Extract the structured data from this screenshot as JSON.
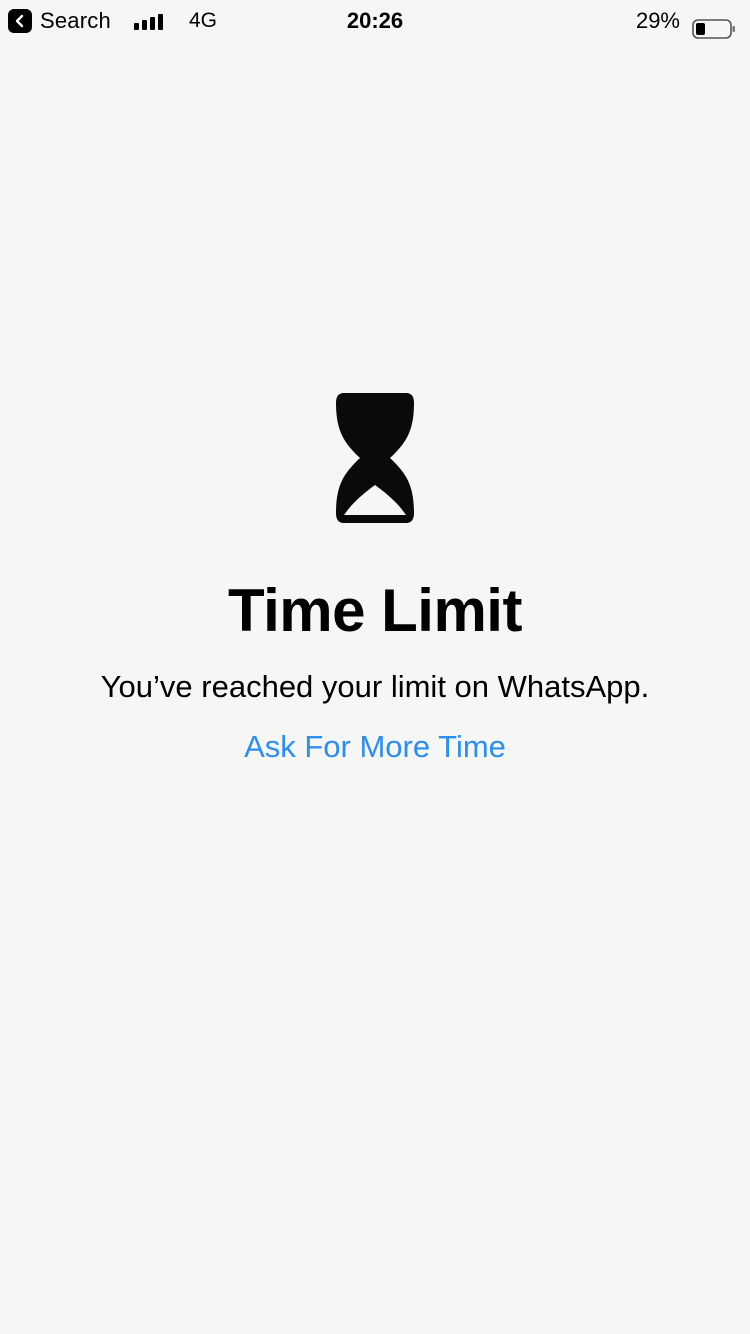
{
  "status_bar": {
    "back_app_label": "Search",
    "network": "4G",
    "time": "20:26",
    "battery_percent": "29%",
    "battery_level": 0.29
  },
  "screen": {
    "icon": "hourglass-icon",
    "title": "Time Limit",
    "message": "You’ve reached your limit on WhatsApp.",
    "ask_link": "Ask For More Time",
    "link_color": "#2c8ef0",
    "background_color": "#f6f6f4"
  }
}
